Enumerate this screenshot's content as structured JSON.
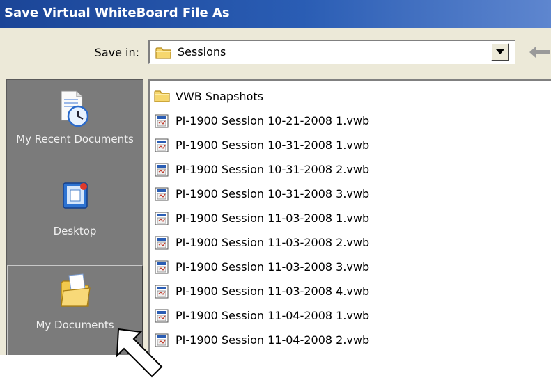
{
  "window": {
    "title": "Save Virtual WhiteBoard File As"
  },
  "save_in": {
    "label": "Save in:",
    "value": "Sessions"
  },
  "toolbar": {
    "back_icon": "back-arrow-icon"
  },
  "places": {
    "recent": "My Recent Documents",
    "desktop": "Desktop",
    "my_documents": "My Documents"
  },
  "files": [
    {
      "name": "VWB Snapshots",
      "icon": "folder-icon"
    },
    {
      "name": "PI-1900 Session 10-21-2008 1.vwb",
      "icon": "vwb-file-icon"
    },
    {
      "name": "PI-1900 Session 10-31-2008 1.vwb",
      "icon": "vwb-file-icon"
    },
    {
      "name": "PI-1900 Session 10-31-2008 2.vwb",
      "icon": "vwb-file-icon"
    },
    {
      "name": "PI-1900 Session 10-31-2008 3.vwb",
      "icon": "vwb-file-icon"
    },
    {
      "name": "PI-1900 Session 11-03-2008 1.vwb",
      "icon": "vwb-file-icon"
    },
    {
      "name": "PI-1900 Session 11-03-2008 2.vwb",
      "icon": "vwb-file-icon"
    },
    {
      "name": "PI-1900 Session 11-03-2008 3.vwb",
      "icon": "vwb-file-icon"
    },
    {
      "name": "PI-1900 Session 11-03-2008 4.vwb",
      "icon": "vwb-file-icon"
    },
    {
      "name": "PI-1900 Session 11-04-2008 1.vwb",
      "icon": "vwb-file-icon"
    },
    {
      "name": "PI-1900 Session 11-04-2008 2.vwb",
      "icon": "vwb-file-icon"
    }
  ],
  "colors": {
    "title_bar": "#1f4e9c",
    "places_bar": "#7b7b7b",
    "dialog_face": "#ece9d8"
  }
}
